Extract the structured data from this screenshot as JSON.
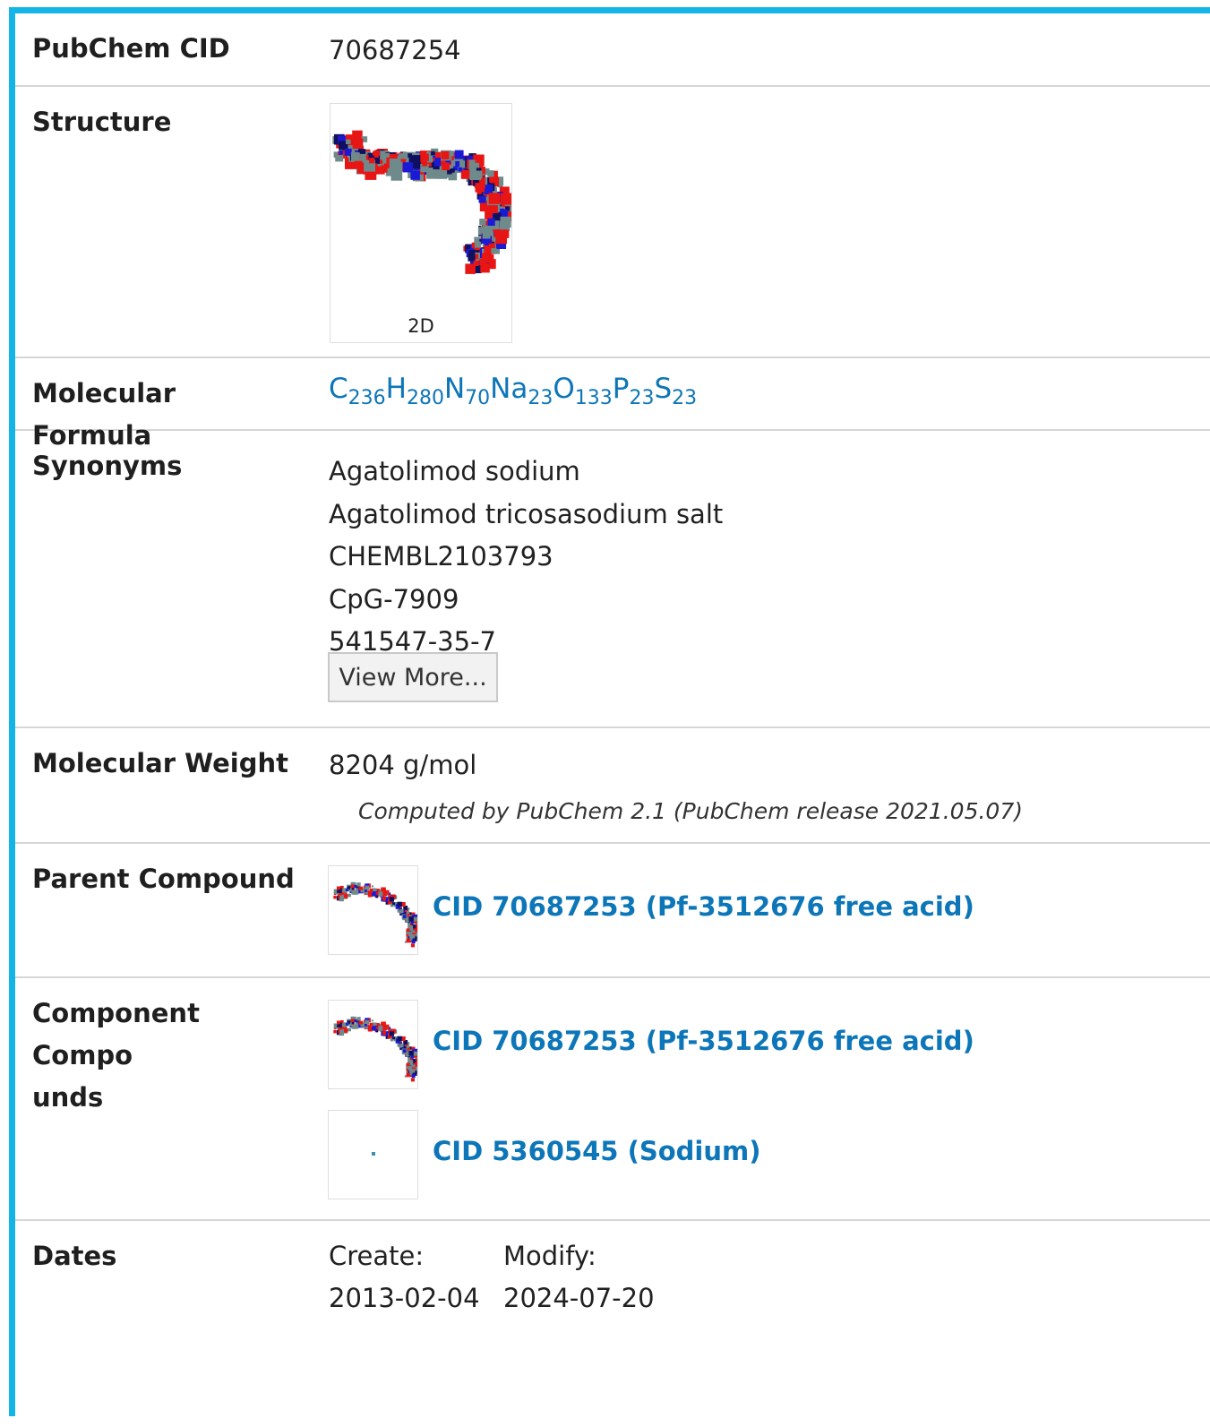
{
  "rows": {
    "cid": {
      "label": "PubChem CID",
      "value": "70687254"
    },
    "structure": {
      "label": "Structure",
      "caption": "2D"
    },
    "formula": {
      "label": "Molecular Formula",
      "parts": [
        {
          "el": "C",
          "n": "236"
        },
        {
          "el": "H",
          "n": "280"
        },
        {
          "el": "N",
          "n": "70"
        },
        {
          "el": "Na",
          "n": "23"
        },
        {
          "el": "O",
          "n": "133"
        },
        {
          "el": "P",
          "n": "23"
        },
        {
          "el": "S",
          "n": "23"
        }
      ]
    },
    "synonyms": {
      "label": "Synonyms",
      "items": [
        "Agatolimod sodium",
        "Agatolimod tricosasodium salt",
        "CHEMBL2103793",
        "CpG-7909",
        "541547-35-7"
      ],
      "button": "View More..."
    },
    "weight": {
      "label": "Molecular Weight",
      "value": "8204 g/mol",
      "note": "Computed by PubChem 2.1 (PubChem release 2021.05.07)"
    },
    "parent": {
      "label": "Parent Compound",
      "link": "CID 70687253 (Pf-3512676 free acid)"
    },
    "components": {
      "label_line1": "Component Compo",
      "label_line2": "unds",
      "links": [
        "CID 70687253 (Pf-3512676 free acid)",
        "CID 5360545 (Sodium)"
      ]
    },
    "dates": {
      "label": "Dates",
      "create_label": "Create:",
      "create_value": "2013-02-04",
      "modify_label": "Modify:",
      "modify_value": "2024-07-20"
    }
  },
  "colors": {
    "accent": "#13b5e6",
    "link": "#0d76b8",
    "divider": "#d6d6d6"
  }
}
